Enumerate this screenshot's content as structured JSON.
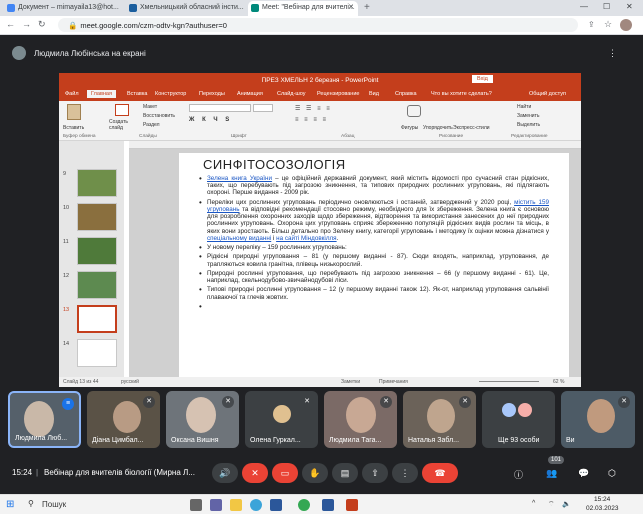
{
  "browser": {
    "tabs": [
      {
        "title": "Документ – mimayaila13@hot..."
      },
      {
        "title": "Хмельницький обласний інсти..."
      },
      {
        "title": "Meet: \"Вебінар для вчителі..."
      }
    ],
    "url": "meet.google.com/czm-odtv-kgn?authuser=0"
  },
  "meet": {
    "presenter_label": "Людмила Любінська на екрані",
    "time": "15:24",
    "meeting_title": "Вебінар для вчителів біології (Мирна Л...",
    "participant_count": "101",
    "participants": [
      {
        "name": "Людмила Люб..."
      },
      {
        "name": "Діана Цимбал..."
      },
      {
        "name": "Оксана Вишня"
      },
      {
        "name": "Олена Гуркал..."
      },
      {
        "name": "Людмила Тага..."
      },
      {
        "name": "Наталья Забл..."
      },
      {
        "name": "Ще 93 особи"
      },
      {
        "name": "Ви"
      }
    ]
  },
  "ppt": {
    "title": "ПРЕЗ ХМЕЛЬН 2 березня  -  PowerPoint",
    "login": "Вхід",
    "tabs": [
      "Файл",
      "Главная",
      "Вставка",
      "Конструктор",
      "Переходы",
      "Анимация",
      "Слайд-шоу",
      "Рецензирование",
      "Вид",
      "Справка",
      "Что вы хотите сделать?",
      "Общий доступ"
    ],
    "ribbon": {
      "paste": "Вставить",
      "create_slide": "Создать слайд",
      "layout": "Макет",
      "reset": "Восстановить",
      "section": "Раздел",
      "shapes": "Фигуры",
      "arrange": "Упорядочить",
      "styles": "Экспресс-стили",
      "find": "Найти",
      "replace": "Заменить",
      "select": "Выделить",
      "clipboard": "Буфер обмена",
      "slides": "Слайды",
      "font": "Шрифт",
      "paragraph": "Абзац",
      "drawing": "Рисование",
      "editing": "Редактирование"
    },
    "thumb_numbers": [
      "9",
      "10",
      "11",
      "12",
      "13",
      "14"
    ],
    "slide": {
      "title": "СИНФІТОСОЗОЛОГІЯ",
      "b1_link": "Зелена книга України",
      "b1_text": " – це офіційний державний документ, який містить відомості про сучасний стан рідкісних, таких, що перебувають під загрозою зникнення, та типових природних рослинних угруповань, які підлягають охороні.  Перше видання - 2009 рік.",
      "b2_text1": "Переліки цих рослинних угруповань періодично оновлюються і останній, затверджений у 2020 році, ",
      "b2_link1": "містить 159 угруповань",
      "b2_text2": " та відповідні рекомендації стосовно режиму, необхідного для їх збереження. Зелена книга є основою для розроблення охоронних заходів щодо збереження, відтворення та використання занесених до неї природних рослинних угруповань. Охорона цих угруповань сприяє збереженню популяцій рідкісних видів рослин та місць, в яких вони зростають. Більш детально про Зелену книгу, категорії угруповань і методику їх оцінки можна дізнатися у ",
      "b2_link2": "спеціальному виданні",
      "b2_text3": " і ",
      "b2_link3": "на сайті Міндовкілля",
      "b2_text4": ".",
      "b3": "У новому переліку – 159 рослинних угруповань:",
      "b4": "Рідкісні природні угруповання – 81 (у першому виданні - 87). Сюди входять, наприклад, угруповання, де трапляються ковила гранітна, плівець низькорослий.",
      "b5": "Природні рослинні угруповання, що перебувають під загрозою зникнення – 66 (у першому виданні - 61). Це, наприклад, скельнодубово-звичайнодубові ліси.",
      "b6": "Типові природні рослинні угруповання – 12 (у першому виданні також 12). Як-от, наприклад угруповання сальвінії плаваючої та глечів жовтих."
    },
    "status": {
      "slide_counter": "Слайд 13 из 44",
      "language": "русский",
      "notes": "Заметки",
      "comments": "Примечания",
      "zoom": "62 %"
    }
  },
  "taskbar": {
    "search": "Пошук",
    "time": "15:24",
    "date": "02.03.2023"
  }
}
